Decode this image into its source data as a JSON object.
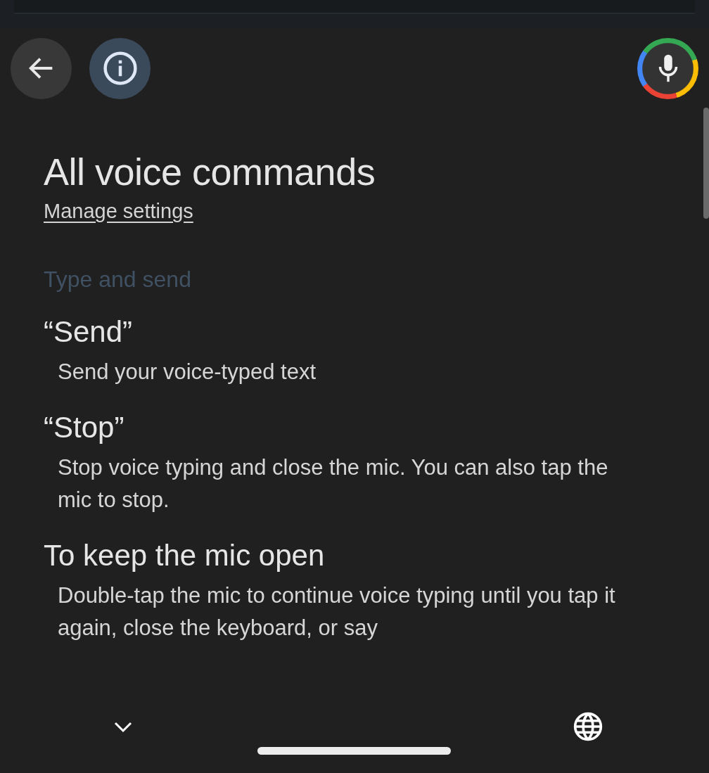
{
  "title": "All voice commands",
  "link": "Manage settings",
  "section": "Type and send",
  "commands": [
    {
      "title": "“Send”",
      "description": "Send your voice-typed text"
    },
    {
      "title": "“Stop”",
      "description": "Stop voice typing and close the mic. You can also tap the mic to stop."
    },
    {
      "title": "To keep the mic open",
      "description": "Double-tap the mic to continue voice typing until you tap it again, close the keyboard, or say"
    }
  ]
}
